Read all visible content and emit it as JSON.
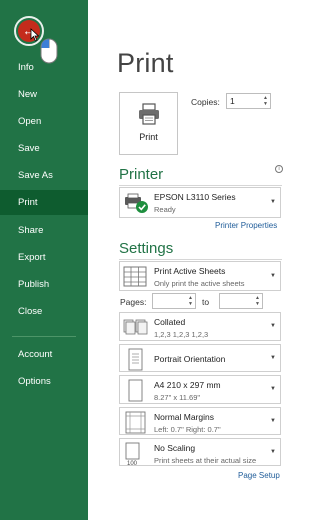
{
  "nav": {
    "items": [
      {
        "label": "Info"
      },
      {
        "label": "New"
      },
      {
        "label": "Open"
      },
      {
        "label": "Save"
      },
      {
        "label": "Save As"
      },
      {
        "label": "Print",
        "active": true
      },
      {
        "label": "Share"
      },
      {
        "label": "Export"
      },
      {
        "label": "Publish"
      },
      {
        "label": "Close"
      },
      {
        "label": "Account"
      },
      {
        "label": "Options"
      }
    ],
    "accent_color": "#217346",
    "active_color": "#0e5c2f"
  },
  "page": {
    "title": "Print"
  },
  "print_button": {
    "label": "Print",
    "icon": "printer-icon"
  },
  "copies": {
    "label": "Copies:",
    "value": "1"
  },
  "printer": {
    "heading": "Printer",
    "name": "EPSON L3110 Series",
    "status": "Ready",
    "properties_link": "Printer Properties"
  },
  "settings": {
    "heading": "Settings",
    "print_what": {
      "title": "Print Active Sheets",
      "subtitle": "Only print the active sheets"
    },
    "pages": {
      "label": "Pages:",
      "to": "to",
      "from_value": "",
      "to_value": ""
    },
    "collation": {
      "title": "Collated",
      "subtitle": "1,2,3    1,2,3    1,2,3"
    },
    "orientation": {
      "title": "Portrait Orientation"
    },
    "paper": {
      "title": "A4 210 x 297 mm",
      "subtitle": "8.27\" x 11.69\""
    },
    "margins": {
      "title": "Normal Margins",
      "subtitle": "Left:  0.7\"    Right:  0.7\""
    },
    "scaling": {
      "title": "No Scaling",
      "subtitle": "Print sheets at their actual size",
      "icon_text": "100"
    },
    "page_setup_link": "Page Setup"
  }
}
